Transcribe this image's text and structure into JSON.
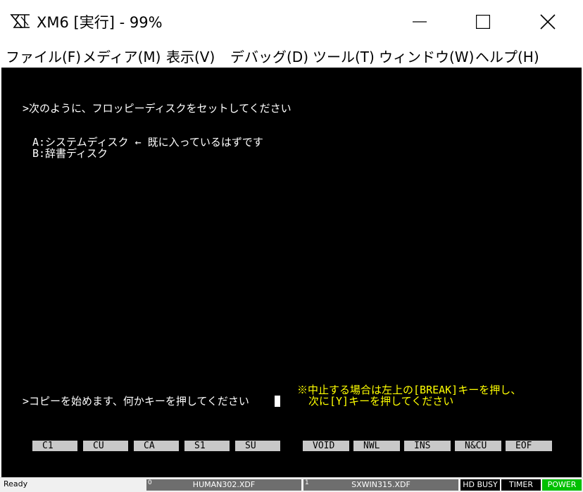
{
  "window": {
    "title": "XM6 [実行] -  99%"
  },
  "menu": [
    {
      "label": "ファイル(F)"
    },
    {
      "label": "メディア(M)"
    },
    {
      "label": "表示(V)"
    },
    {
      "label": "デバッグ(D)"
    },
    {
      "label": "ツール(T)"
    },
    {
      "label": "ウィンドウ(W)"
    },
    {
      "label": "ヘルプ(H)"
    }
  ],
  "screen": {
    "instruction": ">次のように、フロッピーディスクをセットしてください",
    "disk_a": "A:システムディスク ← 既に入っているはずです",
    "disk_b": "B:辞書ディスク",
    "prompt": ">コピーを始めます、何かキーを押してください",
    "notice_line1": "※中止する場合は左上の[BREAK]キーを押し、",
    "notice_line2": "次に[Y]キーを押してください",
    "function_keys": [
      "C1",
      "CU",
      "CA",
      "S1",
      "SU",
      "VOID",
      "NWL",
      "INS",
      "N&CU",
      "EOF"
    ]
  },
  "statusbar": {
    "status": "Ready",
    "drive0_num": "0",
    "drive0_file": "HUMAN302.XDF",
    "drive1_num": "1",
    "drive1_file": "SXWIN315.XDF",
    "hd_busy": "HD BUSY",
    "timer": "TIMER",
    "power": "POWER"
  },
  "colors": {
    "screen_bg": "#000000",
    "screen_text": "#ffffff",
    "notice_text": "#ffff00",
    "power_indicator": "#00c000"
  }
}
